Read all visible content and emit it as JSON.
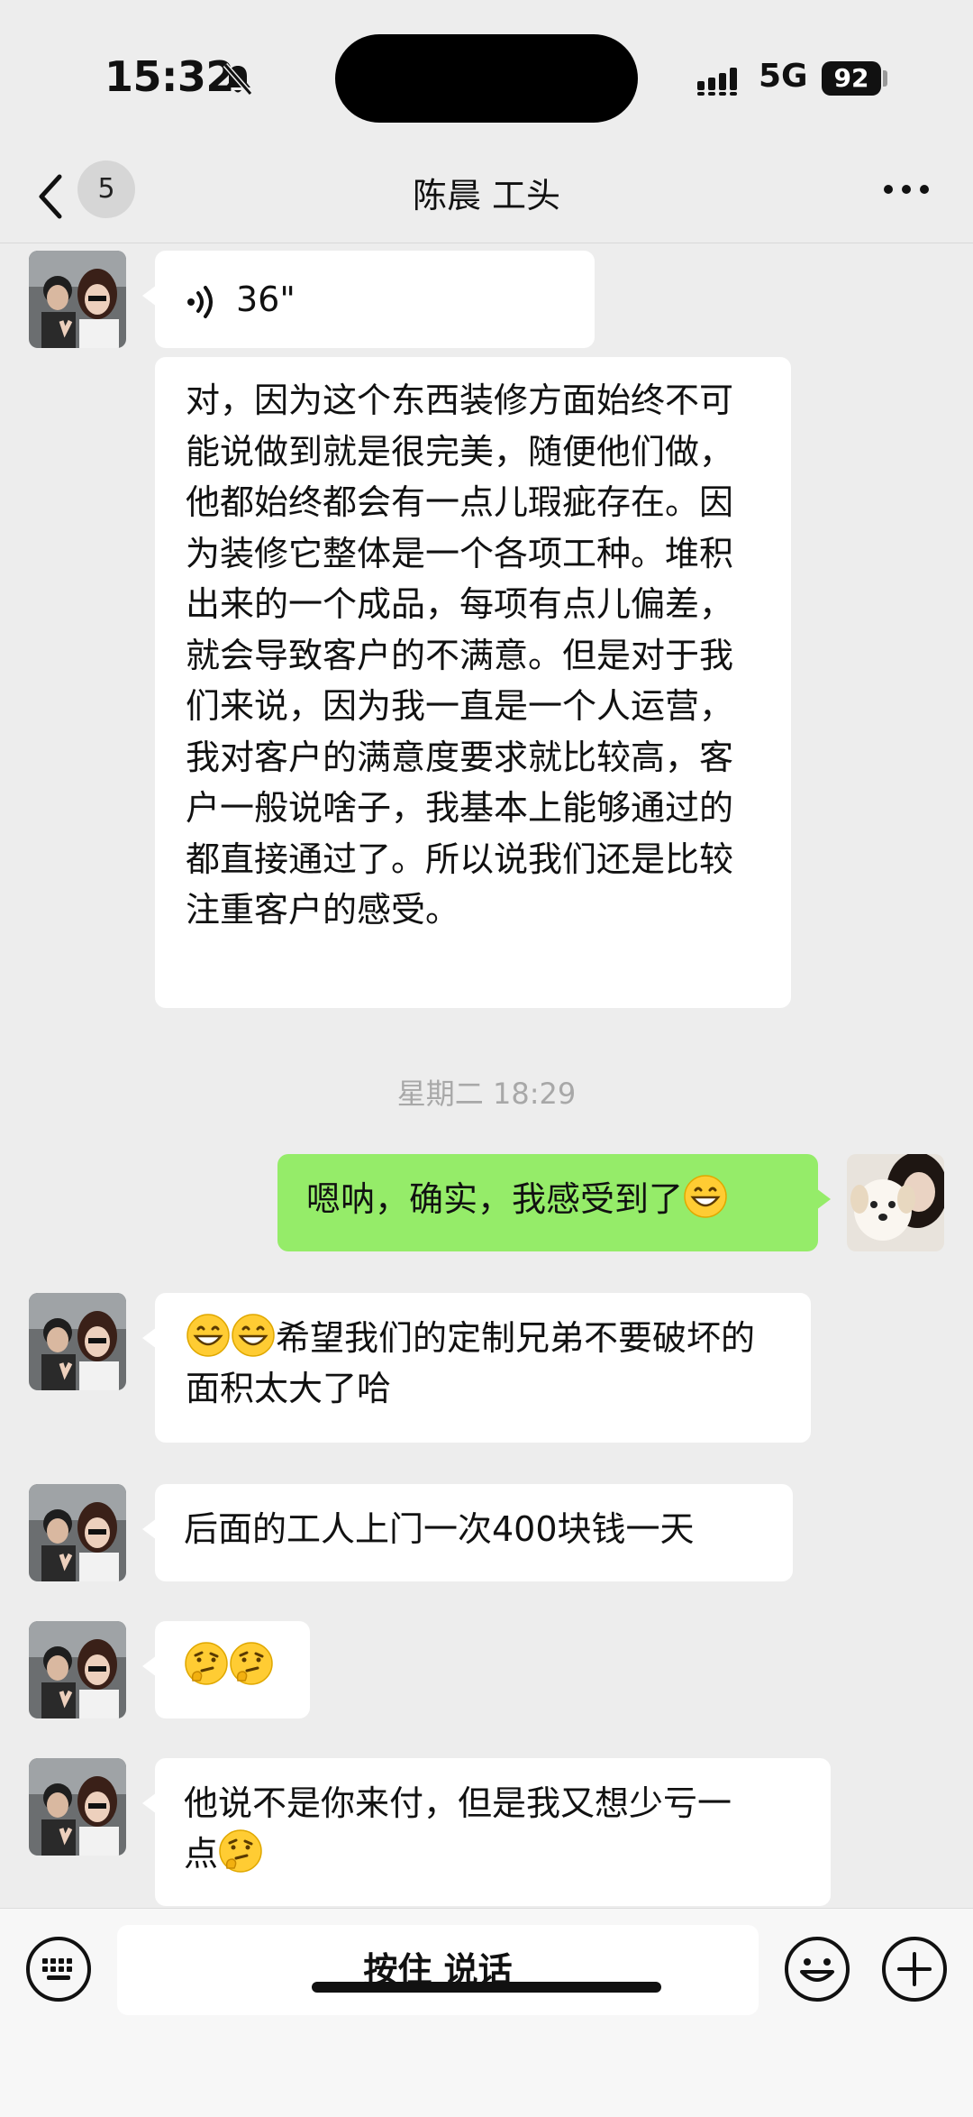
{
  "status": {
    "time": "15:32",
    "network": "5G",
    "battery": "92"
  },
  "nav": {
    "unread_count": "5",
    "title": "陈晨 工头"
  },
  "messages": [
    {
      "type": "voice",
      "duration": "36\""
    },
    {
      "type": "text",
      "text": "对，因为这个东西装修方面始终不可能说做到就是很完美，随便他们做，他都始终都会有一点儿瑕疵存在。因为装修它整体是一个各项工种。堆积出来的一个成品，每项有点儿偏差，就会导致客户的不满意。但是对于我们来说，因为我一直是一个人运营，我对客户的满意度要求就比较高，客户一般说啥子，我基本上能够通过的都直接通过了。所以说我们还是比较注重客户的感受。"
    },
    {
      "type": "timestamp",
      "text": "星期二 18:29"
    },
    {
      "type": "text",
      "sender": "me",
      "text": "嗯呐，确实，我感受到了"
    },
    {
      "type": "text",
      "text": "希望我们的定制兄弟不要破坏的面积太大了哈"
    },
    {
      "type": "text",
      "text": "后面的工人上门一次400块钱一天"
    },
    {
      "type": "emoji",
      "emojis": [
        "thinking-face",
        "thinking-face"
      ]
    },
    {
      "type": "text",
      "line1": "他说不是你来付，但是我又想少亏一",
      "line2": "点"
    }
  ],
  "input_bar": {
    "hold_to_talk": "按住 说话"
  }
}
